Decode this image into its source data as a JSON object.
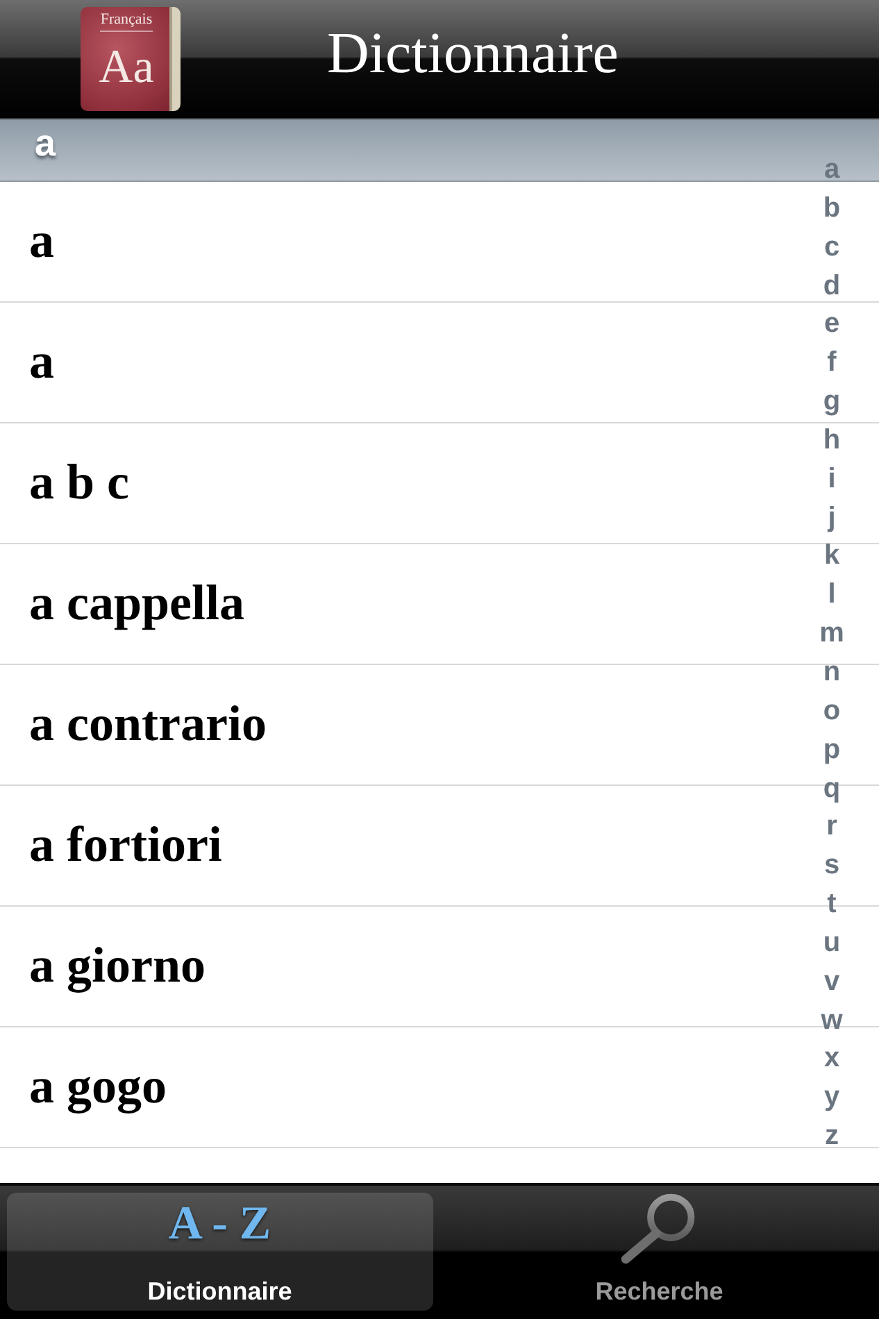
{
  "nav_bar": {
    "logo": {
      "caption": "Français",
      "letters": "Aa"
    },
    "title": "Dictionnaire"
  },
  "section": {
    "header": "a",
    "entries": [
      "a",
      "a",
      "a b c",
      "a cappella",
      "a contrario",
      "a fortiori",
      "a giorno",
      "a gogo"
    ]
  },
  "index": [
    "a",
    "b",
    "c",
    "d",
    "e",
    "f",
    "g",
    "h",
    "i",
    "j",
    "k",
    "l",
    "m",
    "n",
    "o",
    "p",
    "q",
    "r",
    "s",
    "t",
    "u",
    "v",
    "w",
    "x",
    "y",
    "z"
  ],
  "tabs": [
    {
      "kind": "letters",
      "icon_text": "A - Z",
      "label": "Dictionnaire",
      "selected": true
    },
    {
      "kind": "search",
      "label": "Recherche",
      "selected": false
    }
  ]
}
